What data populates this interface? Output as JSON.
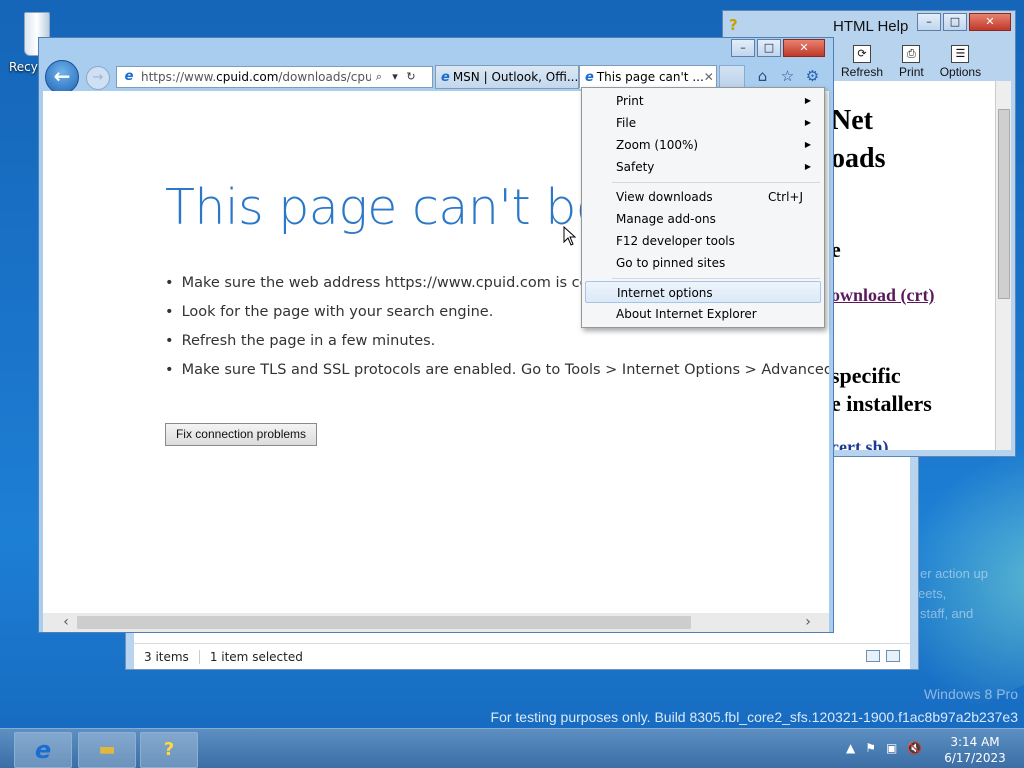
{
  "desktop": {
    "recycle_bin_label": "Recyc"
  },
  "explorer": {
    "status_items": "3 items",
    "status_selected": "1 item selected"
  },
  "help_window": {
    "title": "HTML Help",
    "toolbar": [
      {
        "label": "Refresh",
        "icon": "refresh-icon"
      },
      {
        "label": "Print",
        "icon": "print-icon"
      },
      {
        "label": "Options",
        "icon": "options-icon"
      }
    ],
    "content_lines": [
      "Net",
      "oads",
      "e",
      "ownload (crt)",
      "specific",
      "e installers",
      "cert.sh)"
    ]
  },
  "ie": {
    "address_url_prefix": "https://www.",
    "address_url_domain": "cpuid.com",
    "address_url_rest": "/downloads/cpu-z/c",
    "tabs": [
      {
        "label": "MSN | Outlook, Offi...",
        "active": false
      },
      {
        "label": "This page can't ...",
        "active": true
      }
    ],
    "page": {
      "heading": "This page can't be d",
      "bullets": [
        "Make sure the web address https://www.cpuid.com is correc",
        "Look for the page with your search engine.",
        "Refresh the page in a few minutes.",
        "Make sure TLS and SSL protocols are enabled. Go to Tools > Internet Options > Advanced > Sett"
      ],
      "fix_button": "Fix connection problems"
    }
  },
  "tools_menu": {
    "groups": [
      [
        {
          "label": "Print",
          "submenu": true
        },
        {
          "label": "File",
          "submenu": true
        },
        {
          "label": "Zoom (100%)",
          "submenu": true
        },
        {
          "label": "Safety",
          "submenu": true
        }
      ],
      [
        {
          "label": "View downloads",
          "shortcut": "Ctrl+J"
        },
        {
          "label": "Manage add-ons"
        },
        {
          "label": "F12 developer tools"
        },
        {
          "label": "Go to pinned sites"
        }
      ],
      [
        {
          "label": "Internet options",
          "highlighted": true
        },
        {
          "label": "About Internet Explorer"
        }
      ]
    ]
  },
  "watermark": {
    "edition": "Windows 8 Pro",
    "build": "For testing purposes only. Build 8305.fbl_core2_sfs.120321-1900.f1ac8b97a2b237e3",
    "side_text_1": "er action up",
    "side_text_2": "eets,",
    "side_text_3": "staff, and"
  },
  "taskbar": {
    "time": "3:14 AM",
    "date": "6/17/2023"
  },
  "colors": {
    "ie_blue": "#2b78c9",
    "desktop": "#1a73c8"
  }
}
